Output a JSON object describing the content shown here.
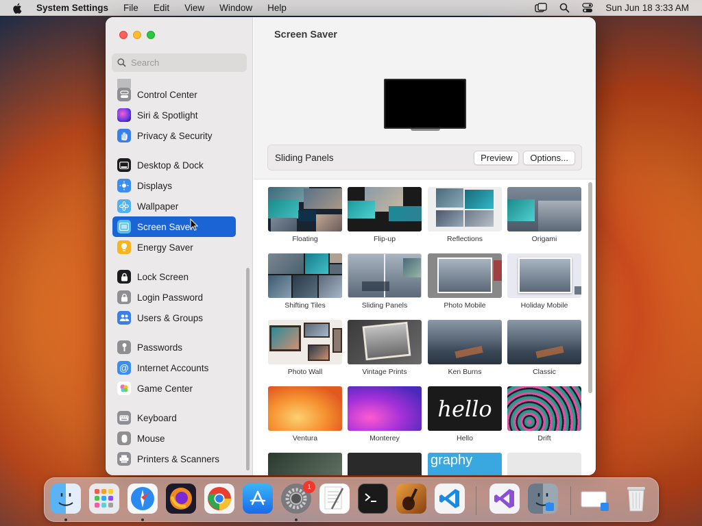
{
  "menubar": {
    "app": "System Settings",
    "items": [
      "File",
      "Edit",
      "View",
      "Window",
      "Help"
    ],
    "clock": "Sun Jun 18  3:33 AM"
  },
  "sidebar": {
    "search_placeholder": "Search",
    "items": [
      {
        "label": "Control Center",
        "icon": "control-center-icon",
        "color": "#8e8e93"
      },
      {
        "label": "Siri & Spotlight",
        "icon": "siri-icon",
        "color": "#6a3cf0"
      },
      {
        "label": "Privacy & Security",
        "icon": "hand-icon",
        "color": "#3a7ee8"
      },
      {
        "label": "Desktop & Dock",
        "icon": "dock-icon",
        "color": "#1c1c1e"
      },
      {
        "label": "Displays",
        "icon": "sun-icon",
        "color": "#3a8ef0"
      },
      {
        "label": "Wallpaper",
        "icon": "flower-icon",
        "color": "#4fb0f2"
      },
      {
        "label": "Screen Saver",
        "icon": "screen-saver-icon",
        "color": "#56c0e8",
        "selected": true
      },
      {
        "label": "Energy Saver",
        "icon": "lightbulb-icon",
        "color": "#f4b520"
      },
      {
        "label": "Lock Screen",
        "icon": "lock-icon",
        "color": "#1c1c1e"
      },
      {
        "label": "Login Password",
        "icon": "key-lock-icon",
        "color": "#8e8e93"
      },
      {
        "label": "Users & Groups",
        "icon": "users-icon",
        "color": "#3a7ee8"
      },
      {
        "label": "Passwords",
        "icon": "key-icon",
        "color": "#8e8e93"
      },
      {
        "label": "Internet Accounts",
        "icon": "at-icon",
        "color": "#3a8ef0"
      },
      {
        "label": "Game Center",
        "icon": "game-center-icon",
        "color": "#ffffff"
      },
      {
        "label": "Keyboard",
        "icon": "keyboard-icon",
        "color": "#8e8e93"
      },
      {
        "label": "Mouse",
        "icon": "mouse-icon",
        "color": "#8e8e93"
      },
      {
        "label": "Printers & Scanners",
        "icon": "printer-icon",
        "color": "#8e8e93"
      }
    ]
  },
  "main": {
    "title": "Screen Saver",
    "current": "Sliding Panels",
    "preview_button": "Preview",
    "options_button": "Options...",
    "savers": [
      "Floating",
      "Flip-up",
      "Reflections",
      "Origami",
      "Shifting Tiles",
      "Sliding Panels",
      "Photo Mobile",
      "Holiday Mobile",
      "Photo Wall",
      "Vintage Prints",
      "Ken Burns",
      "Classic",
      "Ventura",
      "Monterey",
      "Hello",
      "Drift"
    ],
    "hello_text": "hello",
    "partial_text": "graphy"
  },
  "dock": {
    "badge": "1",
    "apps": [
      "Finder",
      "Launchpad",
      "Safari",
      "Firefox",
      "Chrome",
      "App Store",
      "System Settings",
      "TextEdit",
      "Terminal",
      "Instruments",
      "Visual Studio Code",
      "Visual Studio",
      "Finder Copy",
      "Preview",
      "Trash"
    ]
  }
}
